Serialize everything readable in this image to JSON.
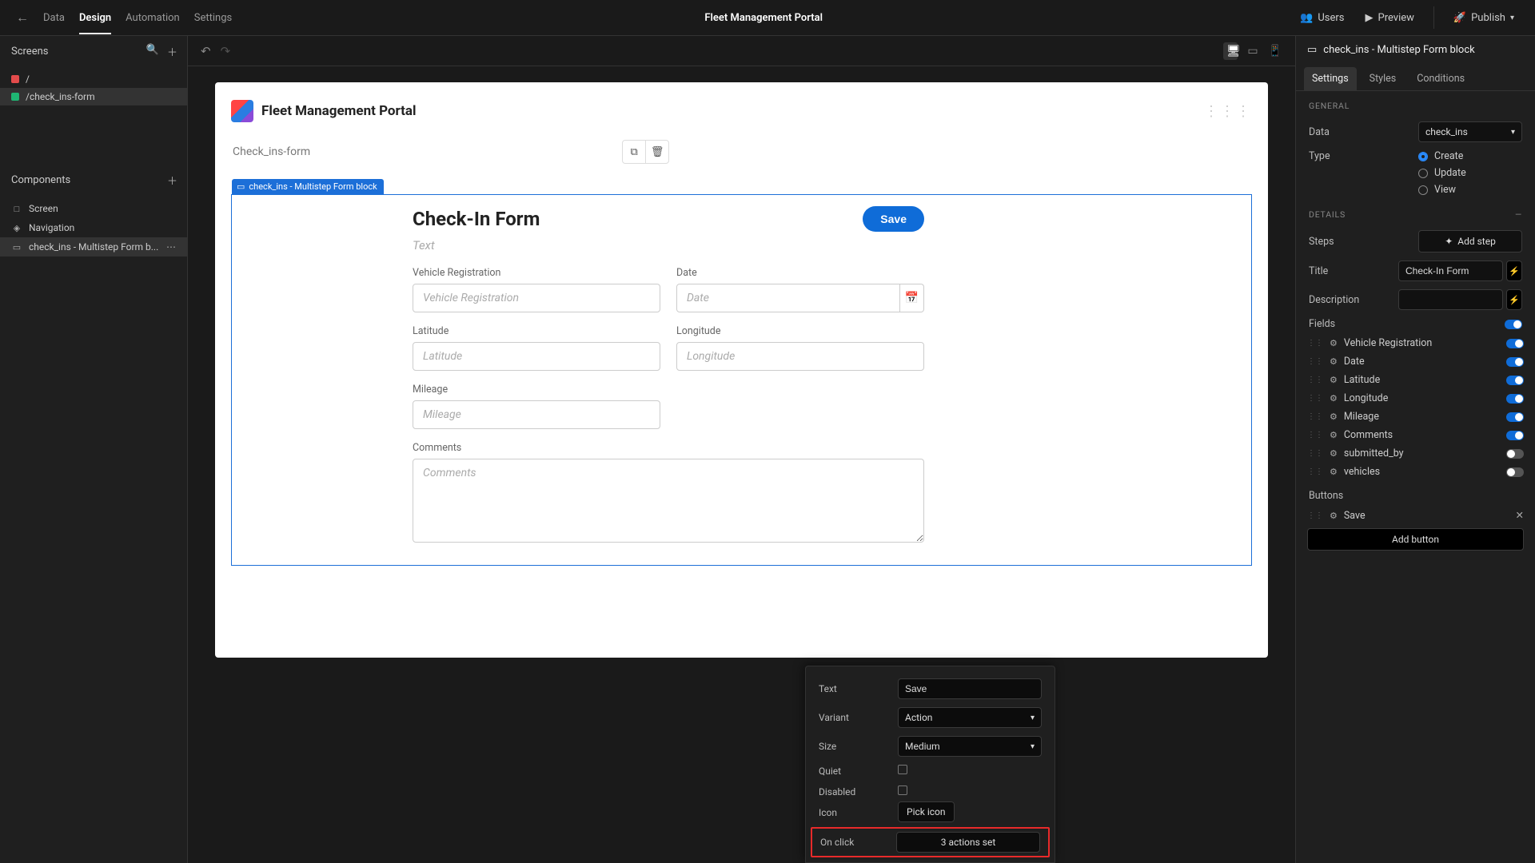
{
  "topbar": {
    "nav": {
      "data": "Data",
      "design": "Design",
      "automation": "Automation",
      "settings": "Settings"
    },
    "title": "Fleet Management Portal",
    "right": {
      "users": "Users",
      "preview": "Preview",
      "publish": "Publish"
    }
  },
  "left": {
    "screens_header": "Screens",
    "screens": [
      {
        "label": "/",
        "dot": "red"
      },
      {
        "label": "/check_ins-form",
        "dot": "green",
        "selected": true
      }
    ],
    "components_header": "Components",
    "components": [
      {
        "icon": "□",
        "label": "Screen"
      },
      {
        "icon": "◈",
        "label": "Navigation"
      },
      {
        "icon": "▭",
        "label": "check_ins - Multistep Form b...",
        "selected": true,
        "more": true
      }
    ]
  },
  "canvas": {
    "app_title": "Fleet Management Portal",
    "breadcrumb": "Check_ins-form",
    "block_tag": "check_ins - Multistep Form block",
    "form": {
      "title": "Check-In Form",
      "save": "Save",
      "desc": "Text",
      "fields": {
        "vehicle_reg": {
          "label": "Vehicle Registration",
          "ph": "Vehicle Registration"
        },
        "date": {
          "label": "Date",
          "ph": "Date"
        },
        "latitude": {
          "label": "Latitude",
          "ph": "Latitude"
        },
        "longitude": {
          "label": "Longitude",
          "ph": "Longitude"
        },
        "mileage": {
          "label": "Mileage",
          "ph": "Mileage"
        },
        "comments": {
          "label": "Comments",
          "ph": "Comments"
        }
      }
    }
  },
  "inspector": {
    "title": "check_ins - Multistep Form block",
    "tabs": {
      "settings": "Settings",
      "styles": "Styles",
      "conditions": "Conditions"
    },
    "general": {
      "header": "GENERAL",
      "data_label": "Data",
      "data_value": "check_ins",
      "type_label": "Type",
      "type_options": {
        "create": "Create",
        "update": "Update",
        "view": "View"
      }
    },
    "details": {
      "header": "DETAILS",
      "steps_label": "Steps",
      "add_step": "Add step",
      "title_label": "Title",
      "title_value": "Check-In Form",
      "desc_label": "Description",
      "desc_value": "",
      "fields_label": "Fields",
      "fields": [
        {
          "label": "Vehicle Registration",
          "on": true
        },
        {
          "label": "Date",
          "on": true
        },
        {
          "label": "Latitude",
          "on": true
        },
        {
          "label": "Longitude",
          "on": true
        },
        {
          "label": "Mileage",
          "on": true
        },
        {
          "label": "Comments",
          "on": true
        },
        {
          "label": "submitted_by",
          "on": false
        },
        {
          "label": "vehicles",
          "on": false
        }
      ],
      "buttons_label": "Buttons",
      "button_save": "Save",
      "add_button": "Add button"
    }
  },
  "popover": {
    "text_label": "Text",
    "text_value": "Save",
    "variant_label": "Variant",
    "variant_value": "Action",
    "size_label": "Size",
    "size_value": "Medium",
    "quiet_label": "Quiet",
    "disabled_label": "Disabled",
    "icon_label": "Icon",
    "icon_btn": "Pick icon",
    "onclick_label": "On click",
    "onclick_value": "3 actions set"
  }
}
